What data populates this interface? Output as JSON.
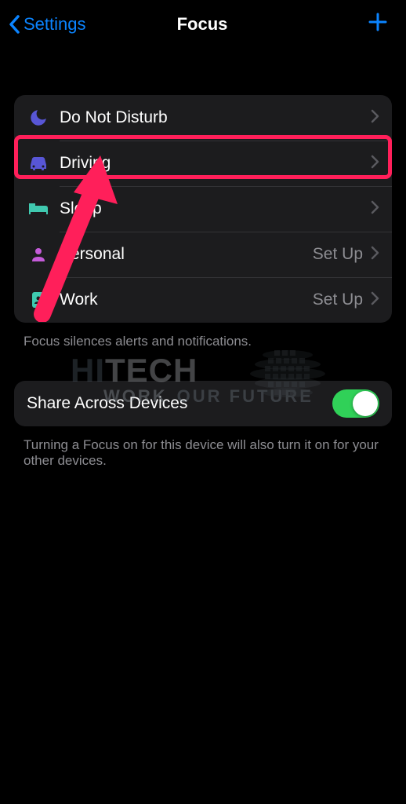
{
  "header": {
    "back_label": "Settings",
    "title": "Focus"
  },
  "focus_list": [
    {
      "key": "dnd",
      "label": "Do Not Disturb",
      "status": "",
      "icon_color": "#5856d6"
    },
    {
      "key": "driving",
      "label": "Driving",
      "status": "",
      "icon_color": "#5856d6"
    },
    {
      "key": "sleep",
      "label": "Sleep",
      "status": "",
      "icon_color": "#40c9b0"
    },
    {
      "key": "personal",
      "label": "Personal",
      "status": "Set Up",
      "icon_color": "#c45bd9"
    },
    {
      "key": "work",
      "label": "Work",
      "status": "Set Up",
      "icon_color": "#3fcab0"
    }
  ],
  "focus_footer": "Focus silences alerts and notifications.",
  "share": {
    "label": "Share Across Devices",
    "enabled": true,
    "footer": "Turning a Focus on for this device will also turn it on for your other devices."
  },
  "watermark": {
    "line1a": "HI",
    "line1b": "TECH",
    "line2a": "WORK",
    "line2b": "OUR FUTURE"
  }
}
